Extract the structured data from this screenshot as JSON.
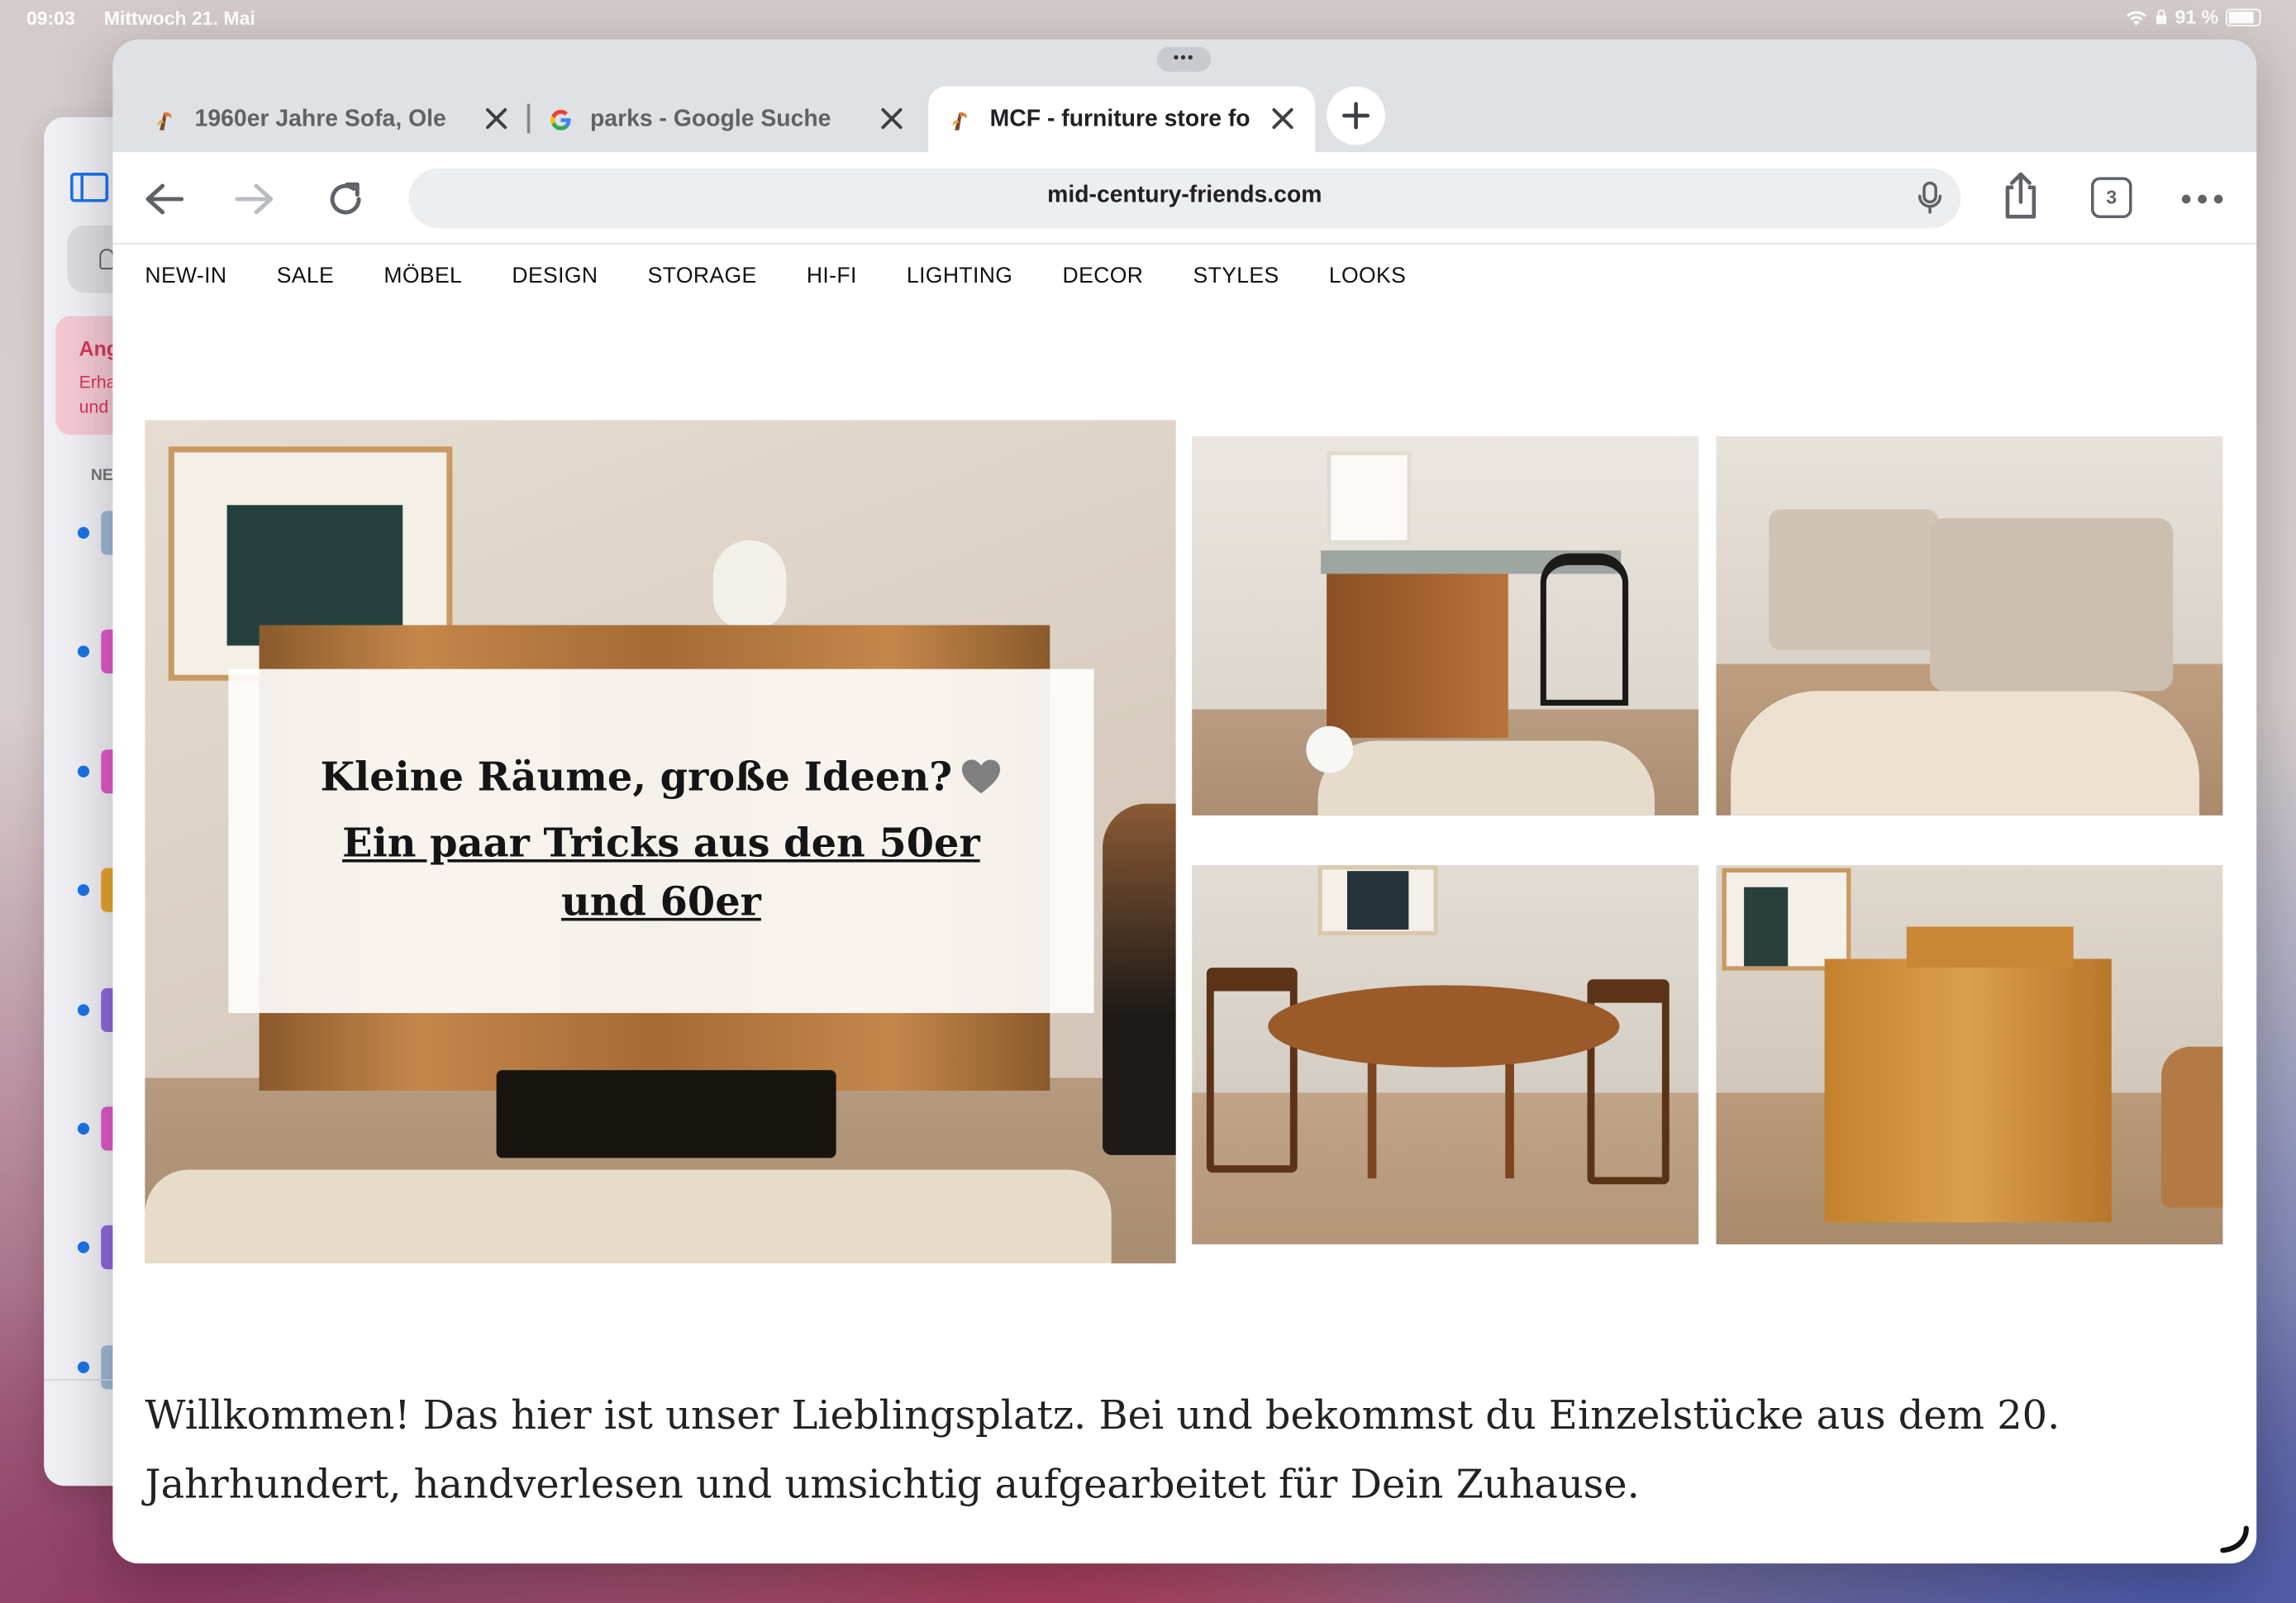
{
  "status_bar": {
    "time": "09:03",
    "date": "Mittwoch 21. Mai",
    "battery": "91 %",
    "icons": [
      "wifi-icon",
      "lock-icon",
      "battery-icon"
    ]
  },
  "background_app": {
    "notice_title": "Ang",
    "notice_line1": "Erha",
    "notice_line2": "und",
    "section_label": "NE",
    "item_swatch_colors": [
      "#9fb8d6",
      "#e05bc8",
      "#e05bc8",
      "#e6a52b",
      "#8e6ae0",
      "#e05bc8",
      "#8e6ae0",
      "#9fb8d6"
    ]
  },
  "browser": {
    "drag_handle": "•••",
    "tabs": [
      {
        "title": "1960er Jahre Sofa, Ole",
        "favicon": "mcf-logo-icon",
        "active": false
      },
      {
        "title": "parks - Google Suche",
        "favicon": "google-icon",
        "active": false
      },
      {
        "title": "MCF - furniture store fo",
        "favicon": "mcf-logo-icon",
        "active": true
      }
    ],
    "url": "mid-century-friends.com",
    "tab_count": "3",
    "colors": {
      "tab_strip": "#dfe1e5",
      "omnibox": "#edeef0",
      "icon": "#5f6368",
      "google_blue": "#4285F4",
      "google_red": "#EA4335",
      "google_yellow": "#FBBC05",
      "google_green": "#34A853"
    }
  },
  "site": {
    "nav": [
      "NEW-IN",
      "SALE",
      "MÖBEL",
      "DESIGN",
      "STORAGE",
      "HI-FI",
      "LIGHTING",
      "DECOR",
      "STYLES",
      "LOOKS"
    ],
    "hero": {
      "heading": "Kleine Räume, große Ideen?",
      "heading_emoji": "grey-heart-icon",
      "link_text": "Ein paar Tricks aus den 50er und 60er"
    },
    "welcome_text": "Willkommen! Das hier ist unser Lieblingsplatz. Bei und bekommst du Einzelstücke aus dem 20. Jahrhundert, handverlesen und umsichtig aufgearbeitet für Dein Zuhause."
  }
}
